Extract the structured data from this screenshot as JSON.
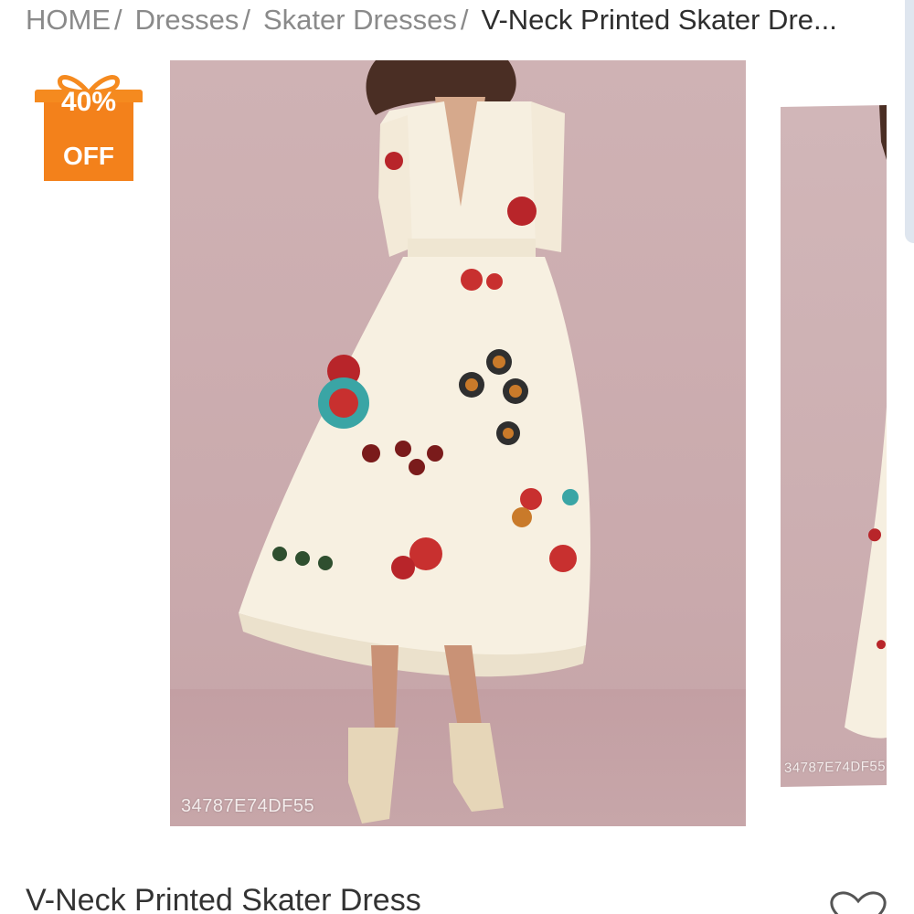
{
  "breadcrumb": {
    "items": [
      "HOME",
      "Dresses",
      "Skater Dresses"
    ],
    "separator": "/",
    "current": "V-Neck Printed Skater Dre..."
  },
  "badge": {
    "percent": "40%",
    "label": "OFF",
    "color": "#f3811b",
    "icon": "gift-icon"
  },
  "gallery": {
    "main_sku": "34787E74DF55",
    "second_sku": "34787E74DF55"
  },
  "product": {
    "title": "V-Neck Printed Skater Dress"
  },
  "icons": {
    "wishlist": "heart-icon"
  }
}
